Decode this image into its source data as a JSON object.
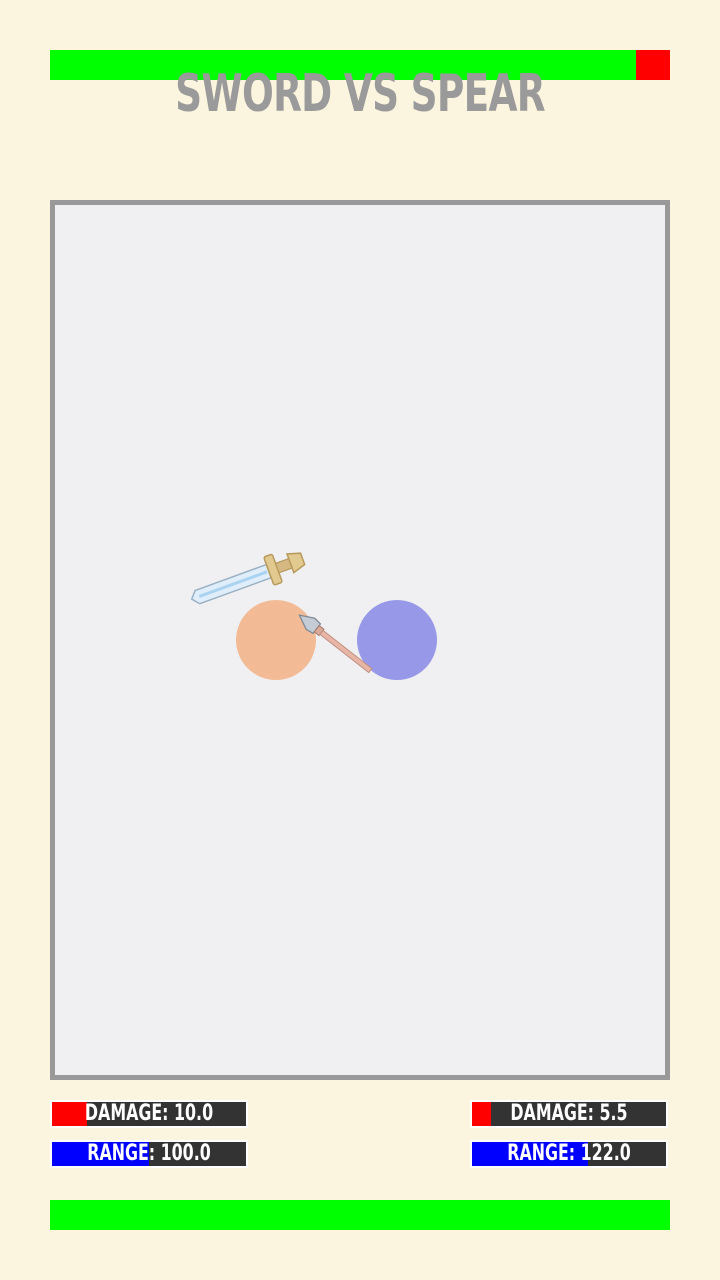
{
  "title": "SWORD VS SPEAR",
  "health": {
    "top": {
      "value": 0.945,
      "fill_color": "#00ff00",
      "empty_color": "#ff0000"
    },
    "bottom": {
      "value": 1.0,
      "fill_color": "#00ff00",
      "empty_color": "#ff0000"
    }
  },
  "fighters": [
    {
      "weapon": "sword",
      "body_color": "#f2bb96",
      "damage_label": "DAMAGE: 10.0",
      "damage_fill": 0.18,
      "range_label": "RANGE: 100.0",
      "range_fill": 0.5
    },
    {
      "weapon": "spear",
      "body_color": "#9799e8",
      "damage_label": "DAMAGE: 5.5",
      "damage_fill": 0.1,
      "range_label": "RANGE: 122.0",
      "range_fill": 0.6
    }
  ],
  "colors": {
    "background": "#fbf4de",
    "arena": "#f0f0f2",
    "arena_border": "#999999",
    "damage": "#ff0000",
    "range": "#0000ff"
  },
  "icons": [
    "sword-icon",
    "spear-icon"
  ]
}
